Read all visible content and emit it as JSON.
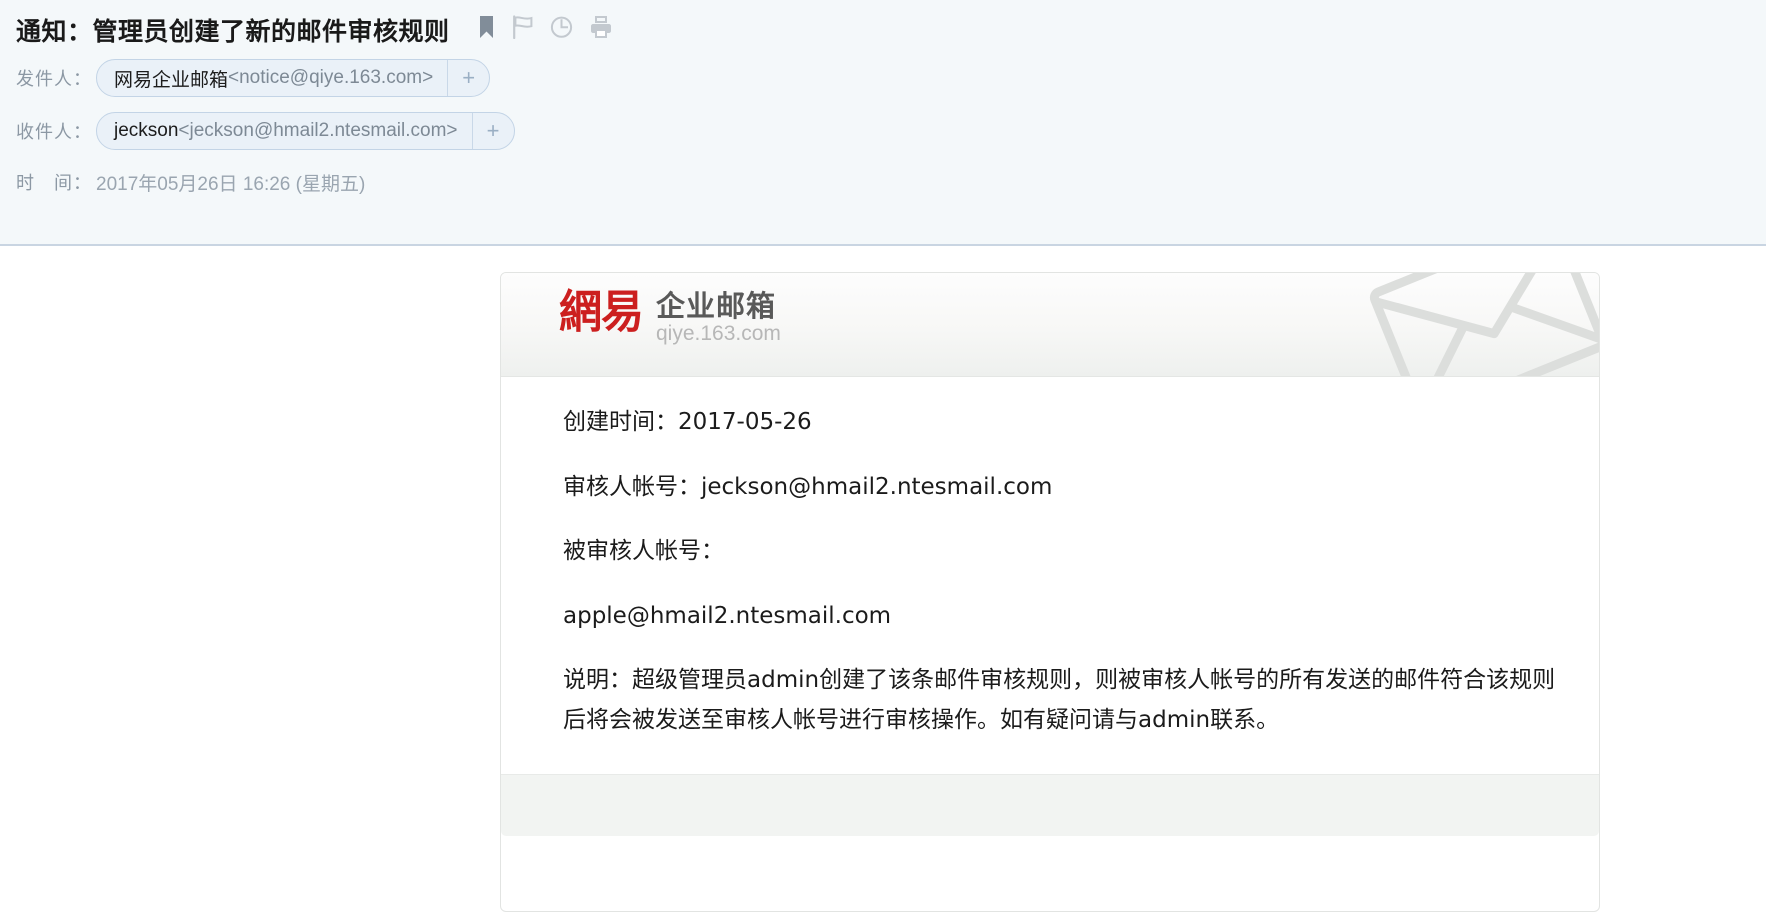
{
  "header": {
    "subject": "通知：管理员创建了新的邮件审核规则",
    "icons": [
      {
        "name": "bookmark-icon",
        "title": "标记"
      },
      {
        "name": "flag-icon",
        "title": "红旗标记"
      },
      {
        "name": "clock-icon",
        "title": "定时"
      },
      {
        "name": "print-icon",
        "title": "打印"
      }
    ],
    "from": {
      "label": "发件人：",
      "name": "网易企业邮箱",
      "email": "<notice@qiye.163.com>",
      "add_label": "+"
    },
    "to": {
      "label": "收件人：",
      "name": "jeckson",
      "email": "<jeckson@hmail2.ntesmail.com>",
      "add_label": "+"
    },
    "time": {
      "label": "时　间：",
      "value": "2017年05月26日 16:26 (星期五)"
    }
  },
  "card": {
    "brand": {
      "cn": "網易",
      "sub": "企业邮箱",
      "domain": "qiye.163.com"
    },
    "watermark_icon": "envelope-icon",
    "lines": [
      "创建时间：2017-05-26",
      "审核人帐号：jeckson@hmail2.ntesmail.com",
      "被审核人帐号：",
      "apple@hmail2.ntesmail.com",
      "说明：超级管理员admin创建了该条邮件审核规则，则被审核人帐号的所有发送的邮件符合该规则后将会被发送至审核人帐号进行审核操作。如有疑问请与admin联系。"
    ]
  },
  "colors": {
    "header_bg": "#f4f8fa",
    "divider": "#c9d5e2",
    "pill_bg": "#eaf1f8",
    "pill_border": "#c3d4e6",
    "brand_red": "#cc1f1f",
    "muted_text": "#8c98a4",
    "footer_bg": "#f2f4f2"
  }
}
